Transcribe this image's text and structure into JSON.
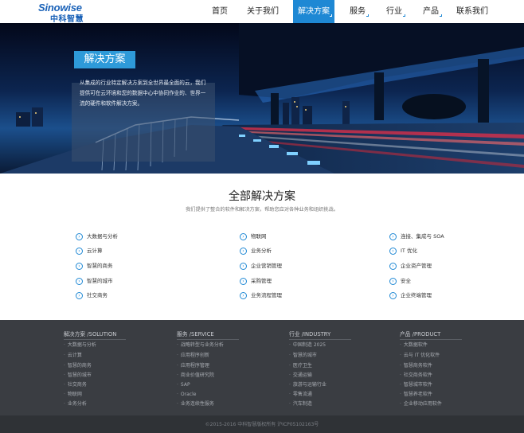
{
  "logo": {
    "en": "Sinowise",
    "cn": "中科智慧"
  },
  "nav": [
    {
      "label": "首页",
      "active": false,
      "dropdown": false
    },
    {
      "label": "关于我们",
      "active": false,
      "dropdown": false
    },
    {
      "label": "解决方案",
      "active": true,
      "dropdown": true
    },
    {
      "label": "服务",
      "active": false,
      "dropdown": true
    },
    {
      "label": "行业",
      "active": false,
      "dropdown": true
    },
    {
      "label": "产品",
      "active": false,
      "dropdown": true
    },
    {
      "label": "联系我们",
      "active": false,
      "dropdown": false
    }
  ],
  "banner": {
    "title": "解决方案",
    "description": "从集成的行业特定解决方案到全世界最全面的云，我们提供可在云环境和您的数据中心中协同作业的、世界一流的硬件和软件解决方案。"
  },
  "solutions": {
    "title": "全部解决方案",
    "subtitle": "我们提供了整合的软件和解决方案，帮助您应对各种业务和组织挑战。",
    "columns": [
      [
        "大数据与分析",
        "云计算",
        "智慧的商务",
        "智慧的城市",
        "社交商务"
      ],
      [
        "物联网",
        "业务分析",
        "企业营销管理",
        "采购管理",
        "业务流程管理"
      ],
      [
        "连接、集成与 SOA",
        "IT 优化",
        "企业资产管理",
        "安全",
        "企业终端管理"
      ]
    ]
  },
  "footer": {
    "columns": [
      {
        "title": "解决方案 /SOLUTION",
        "links": [
          "大数据与分析",
          "云计算",
          "智慧的商务",
          "智慧的城市",
          "社交商务",
          "物联网",
          "业务分析"
        ]
      },
      {
        "title": "服务 /SERVICE",
        "links": [
          "战略转型与业务分析",
          "应用程序创新",
          "应用程序管理",
          "商业价值研究院",
          "SAP",
          "Oracle",
          "业务连续性服务"
        ]
      },
      {
        "title": "行业 /INDUSTRY",
        "links": [
          "中国制造 2025",
          "智慧的城市",
          "医疗卫生",
          "交通运输",
          "旅游与运输行业",
          "零售流通",
          "汽车制造"
        ]
      },
      {
        "title": "产品 /PRODUCT",
        "links": [
          "大数据软件",
          "云与 IT 优化软件",
          "智慧商务软件",
          "社交商务软件",
          "智慧城市软件",
          "智慧养老软件",
          "企业移动应用软件"
        ]
      }
    ],
    "copyright": "©2015-2016 中科智慧版权所有 沪ICP05102163号"
  },
  "colors": {
    "accent": "#1e88d4",
    "footer_bg": "#3a3d42"
  }
}
